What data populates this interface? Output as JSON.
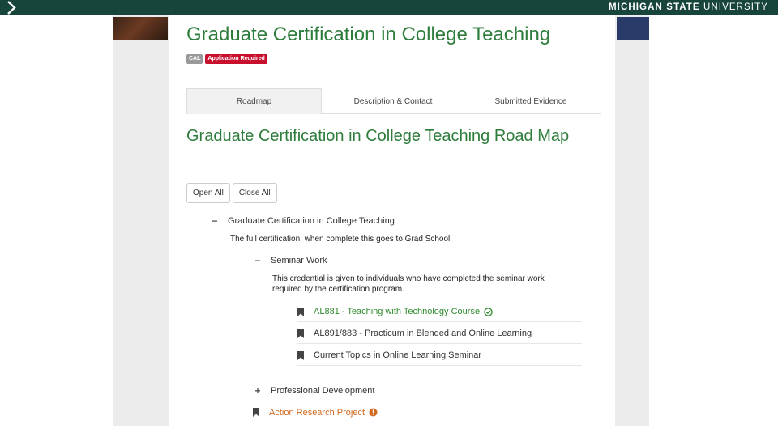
{
  "header": {
    "brand_bold": "MICHIGAN STATE",
    "brand_light": " UNIVERSITY"
  },
  "app": {
    "title": "Graduate Certification in College Teaching",
    "badges": [
      "CAL",
      "Application Required"
    ]
  },
  "tabs": [
    {
      "label": "Roadmap",
      "active": true
    },
    {
      "label": "Description & Contact",
      "active": false
    },
    {
      "label": "Submitted Evidence",
      "active": false
    }
  ],
  "roadmap": {
    "title": "Graduate Certification in College Teaching Road Map",
    "open_all": "Open All",
    "close_all": "Close All",
    "root": {
      "toggle": "−",
      "label": "Graduate Certification in College Teaching",
      "description": "The full certification, when complete this goes to Grad School"
    },
    "seminar": {
      "toggle": "−",
      "label": "Seminar Work",
      "description_line1": "This credential is given to individuals who have completed the seminar work",
      "description_line2": "required by the certification program."
    },
    "courses": [
      {
        "label": "AL881 - Teaching with Technology Course",
        "status": "complete"
      },
      {
        "label": "AL891/883 - Practicum in Blended and Online Learning",
        "status": "none"
      },
      {
        "label": "Current Topics in Online Learning Seminar",
        "status": "none"
      }
    ],
    "professional": {
      "toggle": "+",
      "label": "Professional Development"
    },
    "action": {
      "label": "Action Research Project",
      "status": "warning"
    }
  },
  "colors": {
    "msu_green": "#18453b",
    "title_green": "#2f7d3d",
    "complete_green": "#2f8a2f",
    "warning_orange": "#d2691e",
    "required_red": "#c8102e"
  }
}
